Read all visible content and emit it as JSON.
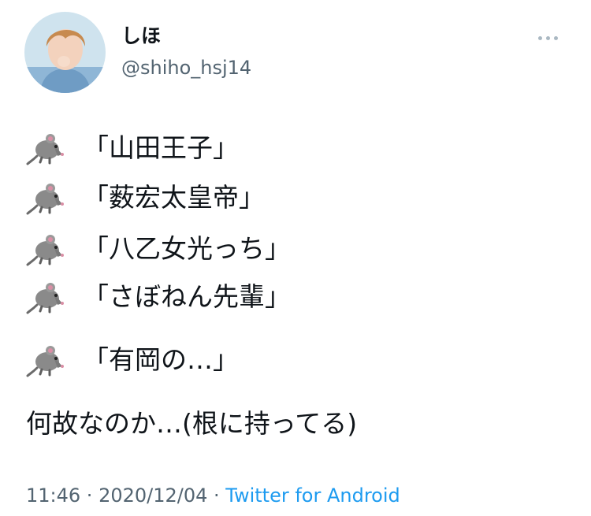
{
  "author": {
    "name": "しほ",
    "handle": "@shiho_hsj14"
  },
  "tweet": {
    "lines": [
      {
        "icon": "rat-emoji",
        "text": "「山田王子」"
      },
      {
        "icon": "rat-emoji",
        "text": "「薮宏太皇帝」"
      },
      {
        "icon": "rat-emoji",
        "text": "「八乙女光っち」"
      },
      {
        "icon": "rat-emoji",
        "text": "「さぼねん先輩」"
      },
      {
        "icon": "rat-emoji",
        "text": "「有岡の…」"
      }
    ],
    "closing": "何故なのか…(根に持ってる)"
  },
  "meta": {
    "time": "11:46",
    "sep1": " · ",
    "date": "2020/12/04",
    "sep2": " · ",
    "source": "Twitter for Android"
  },
  "colors": {
    "text": "#0f1419",
    "secondary": "#536471",
    "link": "#1d9bf0"
  }
}
